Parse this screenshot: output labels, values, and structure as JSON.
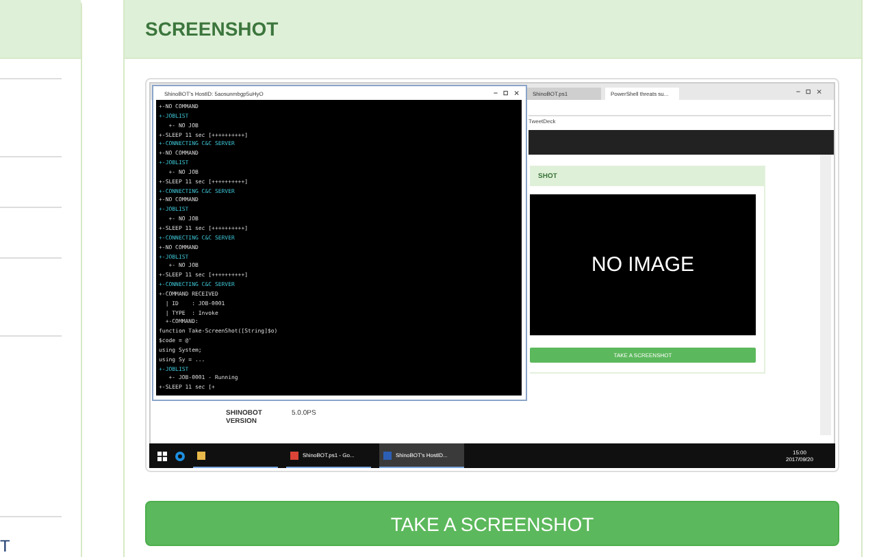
{
  "left_panel": {
    "footer_text": "T"
  },
  "screenshot_card": {
    "title": "SCREENSHOT",
    "button": "TAKE A SCREENSHOT"
  },
  "inner_screen": {
    "browser": {
      "tabs": [
        {
          "label": "ShinoBOT.ps1",
          "selected": false
        },
        {
          "label": "PowerShell threats su...",
          "selected": true
        }
      ],
      "bookmark": "TweetDeck",
      "card_title": "SHOT",
      "image_text": "NO IMAGE",
      "button": "TAKE A SCREENSHOT",
      "info_rows": [
        {
          "label": "SHINOBOT VERSION",
          "value": "5.0.0PS"
        }
      ]
    },
    "console": {
      "title": "ShinoBOT's HostID: 5aosunmbgp5uHyO",
      "lines": [
        {
          "text": "+-NO COMMAND",
          "kind": "plain"
        },
        {
          "text": "+-JOBLIST",
          "kind": "accent"
        },
        {
          "text": "   +- NO JOB",
          "kind": "plain"
        },
        {
          "text": "+-SLEEP 11 sec [++++++++++]",
          "kind": "plain"
        },
        {
          "text": "+-CONNECTING C&C SERVER",
          "kind": "accent"
        },
        {
          "text": "+-NO COMMAND",
          "kind": "plain"
        },
        {
          "text": "+-JOBLIST",
          "kind": "accent"
        },
        {
          "text": "   +- NO JOB",
          "kind": "plain"
        },
        {
          "text": "+-SLEEP 11 sec [++++++++++]",
          "kind": "plain"
        },
        {
          "text": "+-CONNECTING C&C SERVER",
          "kind": "accent"
        },
        {
          "text": "+-NO COMMAND",
          "kind": "plain"
        },
        {
          "text": "+-JOBLIST",
          "kind": "accent"
        },
        {
          "text": "   +- NO JOB",
          "kind": "plain"
        },
        {
          "text": "+-SLEEP 11 sec [++++++++++]",
          "kind": "plain"
        },
        {
          "text": "+-CONNECTING C&C SERVER",
          "kind": "accent"
        },
        {
          "text": "+-NO COMMAND",
          "kind": "plain"
        },
        {
          "text": "+-JOBLIST",
          "kind": "accent"
        },
        {
          "text": "   +- NO JOB",
          "kind": "plain"
        },
        {
          "text": "+-SLEEP 11 sec [++++++++++]",
          "kind": "plain"
        },
        {
          "text": "+-CONNECTING C&C SERVER",
          "kind": "accent"
        },
        {
          "text": "+-COMMAND RECEIVED",
          "kind": "plain"
        },
        {
          "text": "  | ID    : JOB-0001",
          "kind": "plain"
        },
        {
          "text": "  | TYPE  : Invoke",
          "kind": "plain"
        },
        {
          "text": "  +-COMMAND:",
          "kind": "plain"
        },
        {
          "text": "function Take-ScreenShot([String]$o)",
          "kind": "plain"
        },
        {
          "text": "$code = @'",
          "kind": "plain"
        },
        {
          "text": "using System;",
          "kind": "plain"
        },
        {
          "text": "using Sy = ...",
          "kind": "plain"
        },
        {
          "text": "+-JOBLIST",
          "kind": "accent"
        },
        {
          "text": "   +- JOB-0001 - Running",
          "kind": "plain"
        },
        {
          "text": "+-SLEEP 11 sec [+",
          "kind": "plain"
        }
      ]
    },
    "taskbar": {
      "items": [
        {
          "kind": "folder"
        },
        {
          "label": "ShinoBOT.ps1 - Go...",
          "kind": "browser"
        },
        {
          "label": "ShinoBOT's HostID...",
          "kind": "console",
          "selected": true
        }
      ],
      "clock": {
        "time": "15:00",
        "date": "2017/09/20"
      }
    }
  }
}
